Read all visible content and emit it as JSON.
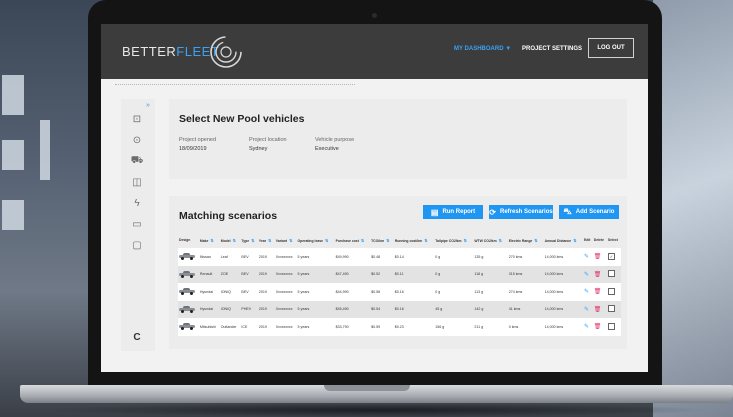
{
  "header": {
    "brand_part1": "BETTER",
    "brand_part2": "FLEET",
    "nav_dashboard": "MY DASHBOARD ▼",
    "nav_project_settings": "PROJECT SETTINGS",
    "logout_label": "LOG OUT"
  },
  "project": {
    "title": "Select New Pool vehicles",
    "opened_label": "Project opened",
    "opened_value": "18/09/2019",
    "location_label": "Project location",
    "location_value": "Sydney",
    "purpose_label": "Vehicle purpose",
    "purpose_value": "Executive"
  },
  "scenarios": {
    "title": "Matching scenarios",
    "run_report_label": "Run Report",
    "refresh_label": "Refresh Scenarios",
    "add_label": "Add Scenario"
  },
  "table": {
    "headers": [
      "Design",
      "Make",
      "Model",
      "Type",
      "Year",
      "Variant",
      "Operating lease",
      "Purchase cost",
      "TCO/km",
      "Running cost/km",
      "Tailpipe CO2/km",
      "WTW CO2/km",
      "Electric Range",
      "Annual Distance",
      "Edit",
      "Delete",
      "Select"
    ],
    "rows": [
      [
        "",
        "Nissan",
        "Leaf",
        "BEV",
        "2019",
        "Xxxxxxxxx",
        "5 years",
        "$49,990",
        "$0.48",
        "$0.14",
        "0 g",
        "135 g",
        "270 kms",
        "14,000 kms"
      ],
      [
        "",
        "Renault",
        "ZOE",
        "BEV",
        "2019",
        "Xxxxxxxxx",
        "5 years",
        "$47,490",
        "$0.52",
        "$0.11",
        "0 g",
        "118 g",
        "315 kms",
        "14,000 kms"
      ],
      [
        "",
        "Hyundai",
        "IONIQ",
        "BEV",
        "2019",
        "Xxxxxxxxx",
        "5 years",
        "$44,990",
        "$0.58",
        "$0.16",
        "0 g",
        "113 g",
        "274 kms",
        "14,000 kms"
      ],
      [
        "",
        "Hyundai",
        "IONIQ",
        "PHEV",
        "2019",
        "Xxxxxxxxx",
        "5 years",
        "$45,490",
        "$0.54",
        "$0.16",
        "45 g",
        "142 g",
        "41 kms",
        "14,000 kms"
      ],
      [
        "",
        "Mitsubishi",
        "Outlander",
        "ICE",
        "2019",
        "Xxxxxxxxx",
        "5 years",
        "$33,790",
        "$0.59",
        "$0.23",
        "156 g",
        "211 g",
        "0 kms",
        "14,000 kms"
      ]
    ]
  },
  "icons": {
    "sidebar": [
      "import-icon",
      "location-icon",
      "vehicle-icon",
      "book-icon",
      "lightning-icon",
      "monitor-icon",
      "chat-icon"
    ],
    "footer": "brand-c-icon"
  },
  "colors": {
    "accent": "#2096f3",
    "header_bg": "#3c3c3c",
    "delete": "#e0306a"
  }
}
